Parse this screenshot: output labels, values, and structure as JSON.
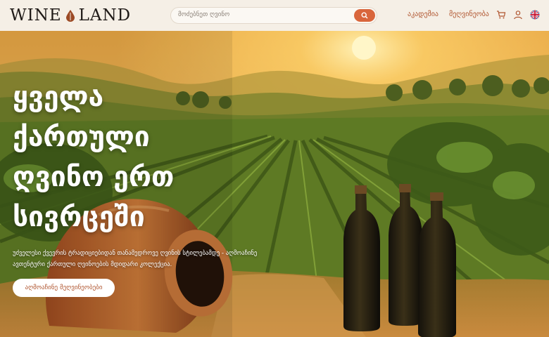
{
  "header": {
    "logo_left": "WINE",
    "logo_right": "LAND",
    "search_placeholder": "მოძებნეთ ღვინო",
    "nav": {
      "academy": "აკადემია",
      "producers": "მეღვინეობა"
    },
    "icons": [
      "search-icon",
      "cart-icon",
      "user-icon",
      "uk-flag-icon"
    ],
    "accent": "#d9663c"
  },
  "hero": {
    "title": "ყველა ქართული ღვინო ერთ სივრცეში",
    "subtitle": "უძველესი ქვევრის ტრადიციებიდან თანამედროვე ღვინის სტილებამდე - აღმოაჩინე ავთენტური ქართული ღვინოების მდიდარი კოლექცია.",
    "cta": "აღმოაჩინე მეღვინეობები"
  }
}
